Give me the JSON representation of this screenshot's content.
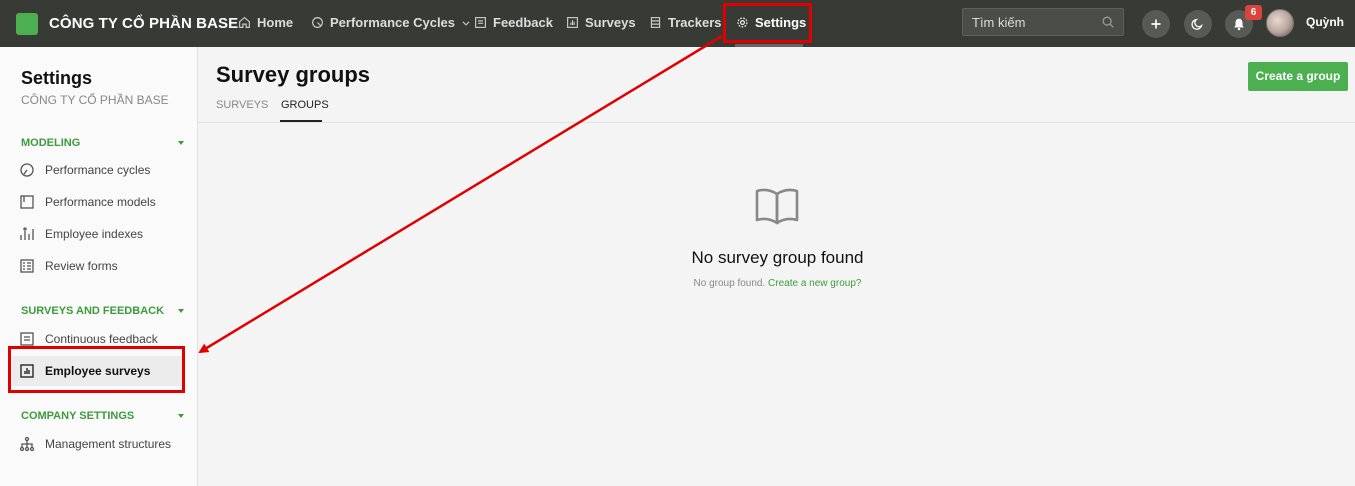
{
  "header": {
    "company": "CÔNG TY CỔ PHẦN BASE",
    "nav": [
      {
        "label": "Home",
        "icon": "home-icon"
      },
      {
        "label": "Performance Cycles",
        "icon": "cycle-icon"
      },
      {
        "label": "Feedback",
        "icon": "feedback-icon"
      },
      {
        "label": "Surveys",
        "icon": "chart-icon"
      },
      {
        "label": "Trackers",
        "icon": "tracker-icon"
      },
      {
        "label": "Settings",
        "icon": "gear-icon"
      }
    ],
    "search_placeholder": "Tìm kiếm",
    "notification_count": "6",
    "user_name": "Quỳnh"
  },
  "sidebar": {
    "title": "Settings",
    "subtitle": "CÔNG TY CỔ PHẦN BASE",
    "sections": [
      {
        "label": "MODELING",
        "items": [
          "Performance cycles",
          "Performance models",
          "Employee indexes",
          "Review forms"
        ]
      },
      {
        "label": "SURVEYS AND FEEDBACK",
        "items": [
          "Continuous feedback",
          "Employee surveys"
        ]
      },
      {
        "label": "COMPANY SETTINGS",
        "items": [
          "Management structures"
        ]
      }
    ]
  },
  "main": {
    "title": "Survey groups",
    "tabs": [
      "SURVEYS",
      "GROUPS"
    ],
    "create_button": "Create a group",
    "empty_title": "No survey group found",
    "empty_text": "No group found.",
    "empty_link": "Create a new group?"
  },
  "colors": {
    "accent": "#4caf50",
    "topbar": "#383b35",
    "highlight": "#e10000"
  }
}
